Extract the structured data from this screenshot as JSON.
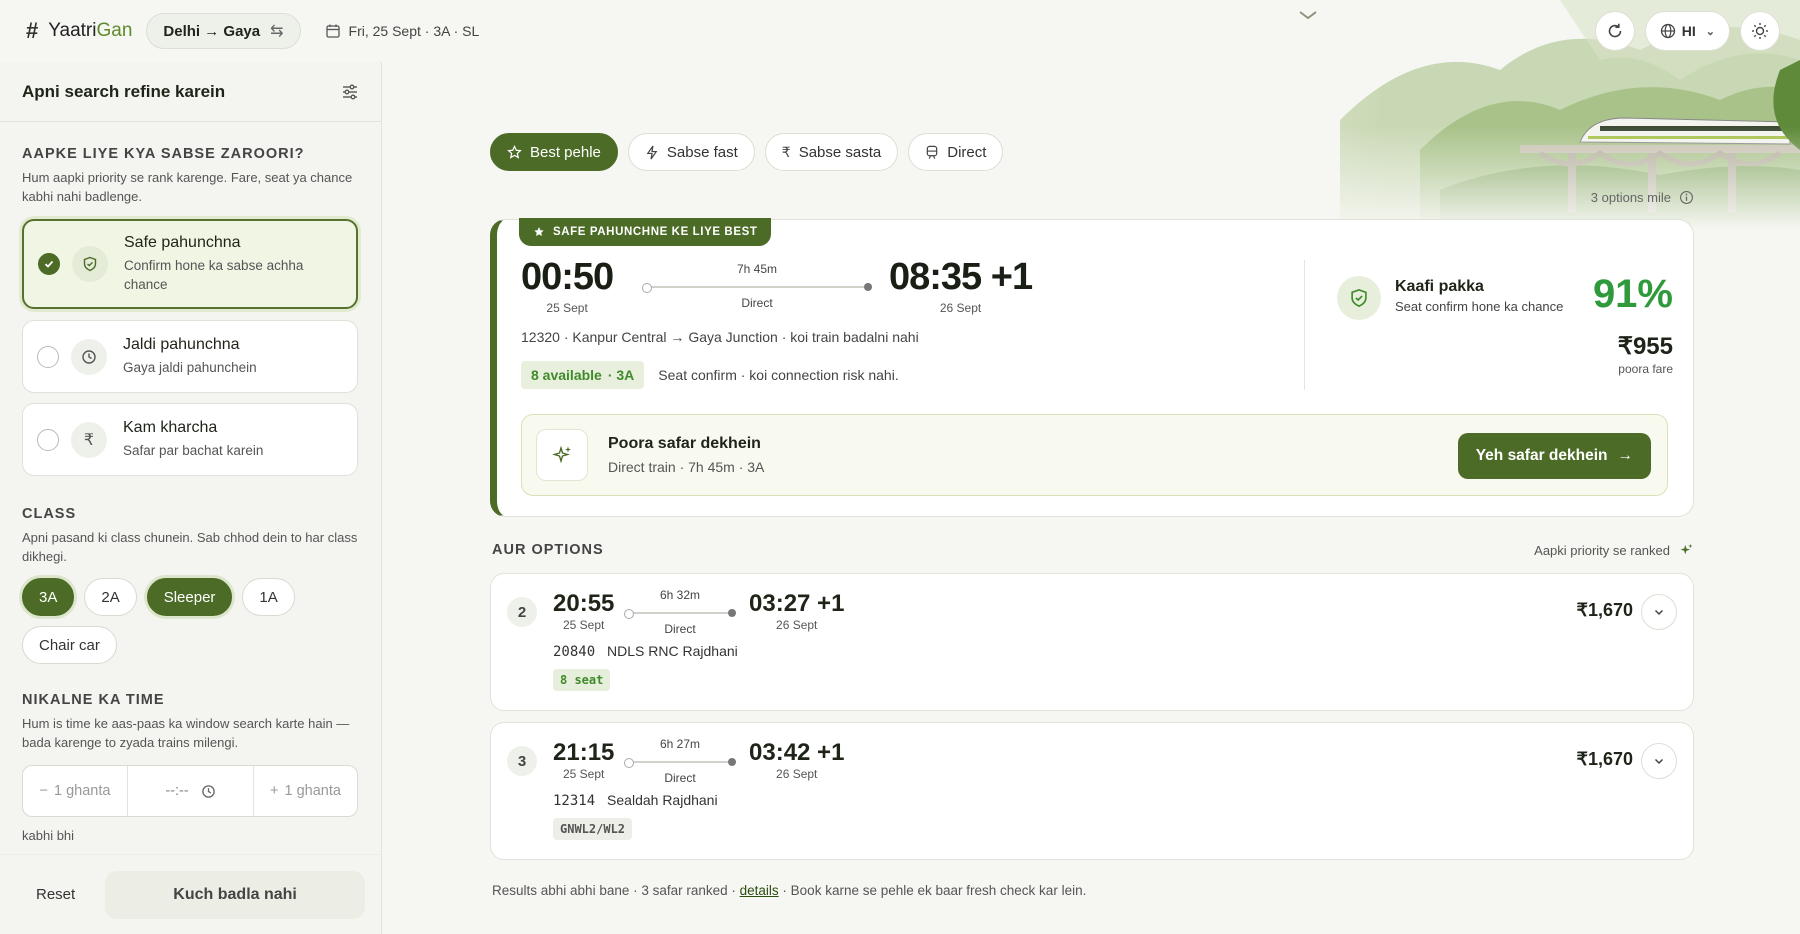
{
  "app": {
    "brand_prefix": "Yaatri",
    "brand_suffix": "Gan"
  },
  "header": {
    "route": "Delhi → Gaya",
    "date_info": "Fri, 25 Sept · 3A · SL",
    "lang": "HI"
  },
  "sidebar": {
    "title": "Apni search refine karein",
    "priority": {
      "title": "AAPKE LIYE KYA SABSE ZAROORI?",
      "desc": "Hum aapki priority se rank karenge. Fare, seat ya chance kabhi nahi badlenge.",
      "options": [
        {
          "title": "Safe pahunchna",
          "sub": "Confirm hone ka sabse achha chance",
          "selected": true,
          "icon": "shield-icon"
        },
        {
          "title": "Jaldi pahunchna",
          "sub": "Gaya jaldi pahunchein",
          "selected": false,
          "icon": "clock-icon"
        },
        {
          "title": "Kam kharcha",
          "sub": "Safar par bachat karein",
          "selected": false,
          "icon": "rupee-icon"
        }
      ]
    },
    "class": {
      "title": "CLASS",
      "desc": "Apni pasand ki class chunein. Sab chhod dein to har class dikhegi.",
      "chips": [
        "3A",
        "2A",
        "Sleeper",
        "1A",
        "Chair car"
      ]
    },
    "time": {
      "title": "NIKALNE KA TIME",
      "desc": "Hum is time ke aas-paas ka window search karte hain — bada karenge to zyada trains milengi.",
      "minus": "1 ghanta",
      "value": "--:--",
      "plus": "1 ghanta",
      "note": "kabhi bhi"
    },
    "footer": {
      "reset": "Reset",
      "apply": "Kuch badla nahi"
    }
  },
  "sort": {
    "tabs": [
      "Best pehle",
      "Sabse fast",
      "Sabse sasta",
      "Direct"
    ],
    "count": "3 options mile"
  },
  "best": {
    "tag": "SAFE PAHUNCHNE KE LIYE BEST",
    "dep_time": "00:50",
    "dep_date": "25 Sept",
    "duration": "7h 45m",
    "type": "Direct",
    "arr_time": "08:35 +1",
    "arr_date": "26 Sept",
    "route_line": "12320 · Kanpur Central → Gaya Junction · koi train badalni nahi",
    "avail": "8 available",
    "avail_class": "· 3A",
    "avail_note": "Seat confirm · koi connection risk nahi.",
    "confidence_title": "Kaafi pakka",
    "confidence_sub": "Seat confirm hone ka chance",
    "confidence_pct": "91%",
    "fare": "₹955",
    "fare_note": "poora fare",
    "journey_title": "Poora safar dekhein",
    "journey_sub": "Direct train · 7h 45m · 3A",
    "cta": "Yeh safar dekhein"
  },
  "more": {
    "title": "AUR OPTIONS",
    "ranked_note": "Aapki priority se ranked",
    "options": [
      {
        "rank": "2",
        "dep": "20:55",
        "dep_date": "25 Sept",
        "dur": "6h 32m",
        "type": "Direct",
        "arr": "03:27 +1",
        "arr_date": "26 Sept",
        "num": "20840",
        "name": "NDLS RNC Rajdhani",
        "badge": "8 seat",
        "fare": "₹1,670"
      },
      {
        "rank": "3",
        "dep": "21:15",
        "dep_date": "25 Sept",
        "dur": "6h 27m",
        "type": "Direct",
        "arr": "03:42 +1",
        "arr_date": "26 Sept",
        "num": "12314",
        "name": "Sealdah Rajdhani",
        "badge": "GNWL2/WL2",
        "fare": "₹1,670"
      }
    ]
  },
  "footnote": {
    "pre": "Results abhi abhi bane · 3 safar ranked · ",
    "link": "details",
    "post": " · Book karne se pehle ek baar fresh check kar lein."
  },
  "colors": {
    "accent": "#4b6b26",
    "success": "#3f8a2a",
    "confidence": "#2f9a3c"
  }
}
